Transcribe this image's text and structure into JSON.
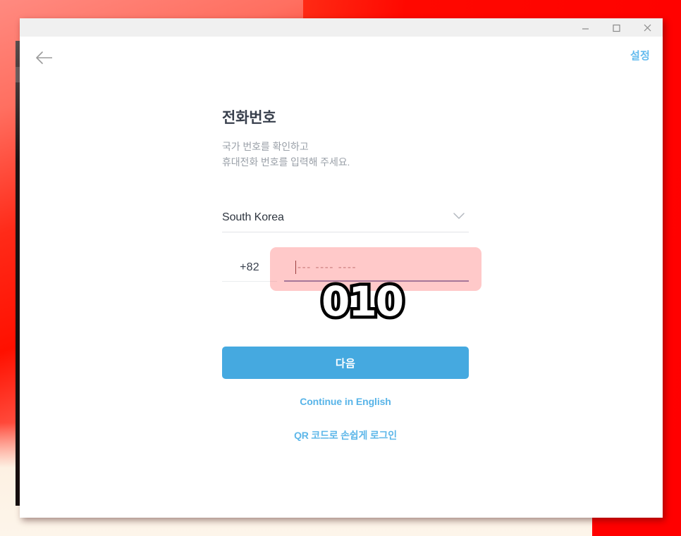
{
  "desktop": {
    "background_top_color": "#ff0d00",
    "background_bottom_color": "#fdf5ea",
    "accent_red": "#ff0000"
  },
  "window": {
    "controls": {
      "minimize_label": "Minimize",
      "maximize_label": "Maximize",
      "close_label": "Close"
    },
    "nav": {
      "back_label": "Back",
      "settings_label": "설정"
    }
  },
  "form": {
    "heading": "전화번호",
    "subtitle_line_1": "국가 번호를 확인하고",
    "subtitle_line_2": "휴대전화 번호를 입력해 주세요.",
    "country": {
      "label": "South Korea",
      "chevron": "chevron-down-icon"
    },
    "phone": {
      "dial_code": "+82",
      "placeholder": "--- ---- ----",
      "value": ""
    },
    "submit_label": "다음",
    "english_link_label": "Continue in English",
    "qr_link_label": "QR 코드로 손쉽게 로그인"
  },
  "annotation": {
    "highlight_color": "#ff5a5a",
    "callout_text": "010",
    "callout_fill": "#ffffff",
    "callout_stroke": "#000000"
  },
  "theme": {
    "primary_button": "#45a9e0",
    "link_blue": "#58b4e8",
    "heading_color": "#383f4c",
    "subtitle_color": "#9aa0a8",
    "input_underline_focus": "#7b84b8",
    "input_underline_idle": "#ebedef"
  }
}
